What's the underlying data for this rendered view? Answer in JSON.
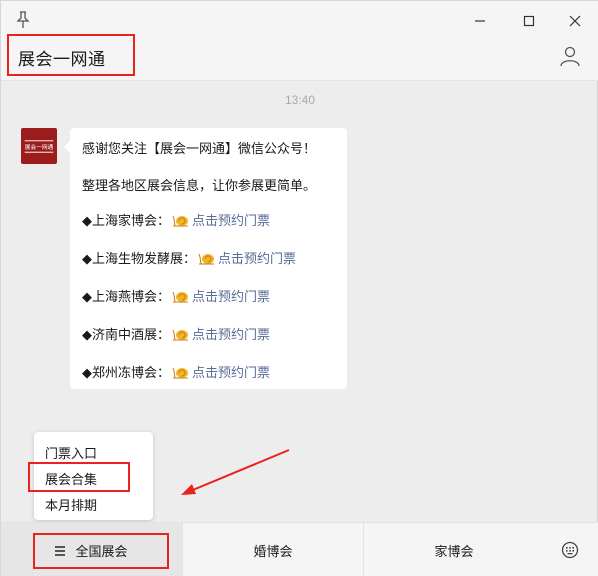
{
  "window": {
    "title": "展会一网通",
    "icons": {
      "pin": "pin-icon",
      "minimize": "minimize-icon",
      "maximize": "maximize-icon",
      "close": "close-icon",
      "profile": "person-icon",
      "keyboard": "keyboard-icon"
    }
  },
  "chat": {
    "timestamp": "13:40",
    "avatar_text": "展会一网通",
    "message": {
      "greeting": "感谢您关注【展会一网通】微信公众号！",
      "intro": "整理各地区展会信息，让你参展更简单。",
      "entries": [
        {
          "name": "◆上海家博会：",
          "link": "点击预约门票"
        },
        {
          "name": "◆上海生物发酵展：",
          "link": "点击预约门票"
        },
        {
          "name": "◆上海燕博会：",
          "link": "点击预约门票"
        },
        {
          "name": "◆济南中酒展：",
          "link": "点击预约门票"
        },
        {
          "name": "◆郑州冻博会：",
          "link": "点击预约门票"
        }
      ]
    }
  },
  "popup_menu": {
    "items": [
      "门票入口",
      "展会合集",
      "本月排期"
    ],
    "highlighted": "展会合集"
  },
  "bottom_menu": {
    "tabs": [
      {
        "label": "全国展会",
        "has_submenu": true
      },
      {
        "label": "婚博会"
      },
      {
        "label": "家博会"
      }
    ]
  },
  "colors": {
    "highlight": "#e8231d",
    "link": "#576b95",
    "avatar_bg": "#9c1c1e",
    "background": "#ededed"
  }
}
